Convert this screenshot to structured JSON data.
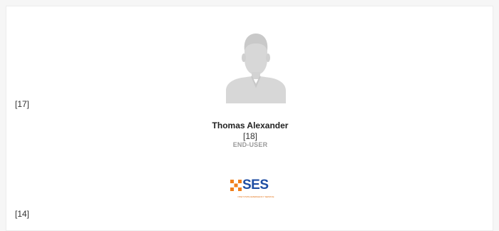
{
  "profile": {
    "ref_top": "[17]",
    "name": "Thomas Alexander",
    "ref_mid": "[18]",
    "role": "END-USER",
    "ref_bottom": "[14]"
  },
  "logo": {
    "text": "SES",
    "subtext": "NSW STATE EMERGENCY SERVICE",
    "colors": {
      "orange": "#f07f1b",
      "blue": "#1f4ea3"
    }
  },
  "icons": {
    "avatar": "user-avatar-placeholder-icon"
  }
}
